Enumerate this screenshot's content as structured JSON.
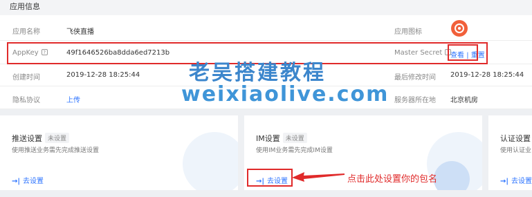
{
  "section_title": "应用信息",
  "info": {
    "app_name_label": "应用名称",
    "app_name_value": "飞侠直播",
    "app_icon_label": "应用图标",
    "appkey_label": "AppKey",
    "appkey_value": "49f1646526ba8dda6ed7213b",
    "master_secret_label": "Master Secret",
    "view_link": "查看",
    "separator": "|",
    "reset_link": "重置",
    "created_label": "创建时间",
    "created_value": "2019-12-28 18:25:44",
    "modified_label": "最后修改时间",
    "modified_value": "2019-12-28 18:25:44",
    "privacy_label": "隐私协议",
    "privacy_value": "上传",
    "server_label": "服务器所在地",
    "server_value": "北京机房"
  },
  "help_icon_text": "?",
  "cards": [
    {
      "title": "推送设置",
      "tag": "未设置",
      "desc": "使用推送业务需先完成推送设置",
      "link": "去设置"
    },
    {
      "title": "IM设置",
      "tag": "未设置",
      "desc": "使用IM业务需先完成IM设置",
      "link": "去设置"
    },
    {
      "title": "认证设置",
      "desc": "使用认证业",
      "link": "去设置"
    }
  ],
  "link_arrow": "→|",
  "watermark": {
    "line1": "老吴搭建教程",
    "line2": "weixiaolive.com"
  },
  "annotation": "点击此处设置你的包名",
  "colors": {
    "link": "#2d74ff",
    "highlight": "#e02a2a",
    "app_icon": "#f1603a"
  }
}
